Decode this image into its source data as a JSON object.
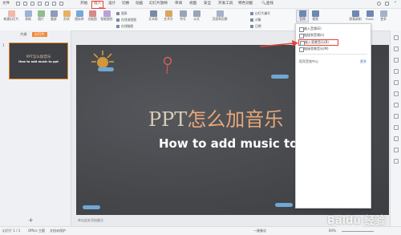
{
  "menubar": {
    "file": "文件",
    "tabs": [
      "开始",
      "插入",
      "设计",
      "切换",
      "动画",
      "幻灯片放映",
      "审阅",
      "视图",
      "安全",
      "开发工具",
      "特色功能"
    ],
    "search": "查找"
  },
  "ribbon": {
    "new_slide": "新建幻灯片",
    "table": "表格",
    "picture": "图片",
    "screenshot": "截屏",
    "shape": "形状",
    "icon_lib": "图标库",
    "function_chart": "功能图",
    "smart_shape": "智能图形",
    "chart": "图表",
    "online_flowchart": "在线流程图",
    "online_mindmap": "在线脑图",
    "textbox": "文本框",
    "art_text": "艺术字",
    "symbol": "符号",
    "formula": "公式",
    "header_footer": "页眉和页脚",
    "slide_number": "幻灯片编号",
    "object": "对象",
    "date_time": "日期",
    "audio": "音频",
    "video": "视频",
    "screen_record": "屏幕录制",
    "flash": "Flash",
    "more": "更多"
  },
  "left_panel": {
    "tab_outline": "大纲",
    "tab_slides": "幻灯片",
    "thumb_number": "1",
    "thumb_title": "PPT怎么加音乐",
    "thumb_subtitle": "How to add music to ppt",
    "add_button": "+"
  },
  "slide": {
    "title_part1": "PPT",
    "title_part2": "怎么加音乐",
    "subtitle": "How to add music to p"
  },
  "dropdown": {
    "items": [
      "嵌入音频(E)",
      "链接到音频(L)",
      "嵌入背景音乐(B)",
      "链接背景音乐(M)"
    ],
    "section_label": "稻壳音效中心",
    "section_link": "更多"
  },
  "notes": {
    "placeholder": "单击此处添加备注"
  },
  "statusbar": {
    "slide_count": "幻灯片 1 / 1",
    "theme": "Office 主题",
    "backup": "文档未保护",
    "beautify": "一键美化",
    "zoom": "84%"
  },
  "watermark": {
    "text": "Baidu 经验",
    "url": "jingyan.baidu.com"
  },
  "colors": {
    "accent": "#e34336",
    "thumb_border": "#e68a2e",
    "slide_bg": "#46484c"
  }
}
